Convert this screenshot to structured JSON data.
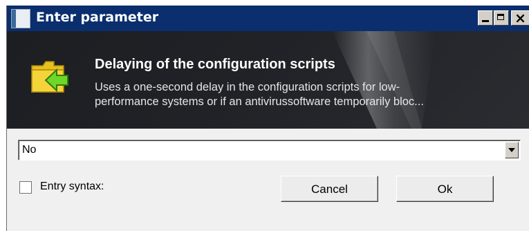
{
  "window": {
    "title": "Enter parameter",
    "icon": "app-icon",
    "controls": {
      "minimize_icon": "minimize-icon",
      "maximize_icon": "maximize-icon",
      "close_label": "×"
    }
  },
  "banner": {
    "icon": "folder-arrow-icon",
    "title": "Delaying of the configuration scripts",
    "description_line1": "Uses a one-second delay in the configuration scripts for low-",
    "description_line2": "performance systems or if an antivirussoftware temporarily bloc..."
  },
  "parameter": {
    "selected_value": "No"
  },
  "entry_syntax": {
    "label": "Entry syntax:",
    "checked": false
  },
  "buttons": {
    "cancel_label": "Cancel",
    "ok_label": "Ok"
  },
  "colors": {
    "titlebar": "#0a2e6e",
    "banner_bg": "#202227",
    "dialog_bg": "#f0f0f0"
  }
}
